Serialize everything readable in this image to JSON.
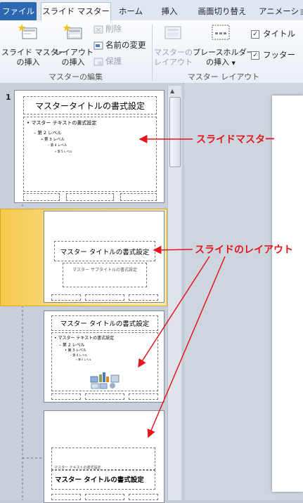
{
  "tabs": {
    "file": "ファイル",
    "slide_master": "スライド マスター",
    "home": "ホーム",
    "insert": "挿入",
    "transitions": "画面切り替え",
    "animations": "アニメーショ"
  },
  "ribbon": {
    "edit_master": {
      "label": "マスターの編集",
      "insert_master_line1": "スライド マスター",
      "insert_master_line2": "の挿入",
      "insert_layout_line1": "レイアウト",
      "insert_layout_line2": "の挿入",
      "delete": "削除",
      "rename": "名前の変更",
      "preserve": "保護"
    },
    "master_layout": {
      "label": "マスター レイアウト",
      "master_layout_line1": "マスターの",
      "master_layout_line2": "レイアウト",
      "insert_placeholder_line1": "プレースホルダー",
      "insert_placeholder_line2": "の挿入",
      "title_checkbox": "タイトル",
      "footer_checkbox": "フッター",
      "title_checked": true,
      "footer_checked": true
    }
  },
  "thumbnails": {
    "slide_number": "1",
    "master": {
      "title": "マスタータイトルの書式設定",
      "bullet1": "マスター テキストの書式設定",
      "bullet2": "第 2 レベル",
      "bullet3": "第 3 レベル",
      "bullet4": "第 4 レベル",
      "bullet5": "第 5 レベル"
    },
    "layout_title": {
      "title": "マスター タイトルの書式設定",
      "subtitle": "マスター サブタイトルの書式設定"
    },
    "layout_content": {
      "title": "マスター タイトルの書式設定",
      "bullet1": "マスター テキストの書式設定",
      "bullet2": "第 2 レベル",
      "bullet3": "第 3 レベル",
      "bullet4": "第 4 レベル",
      "bullet5": "第 5 レベル"
    },
    "layout_section": {
      "small_text": "マスター テキストの書式設定",
      "title": "マスター タイトルの書式設定"
    }
  },
  "annotations": {
    "slide_master": "スライドマスター",
    "slide_layout": "スライドのレイアウト"
  },
  "colors": {
    "annotation": "#e4161c",
    "file_tab": "#2c67b2",
    "selection": "#f7cf5c"
  }
}
